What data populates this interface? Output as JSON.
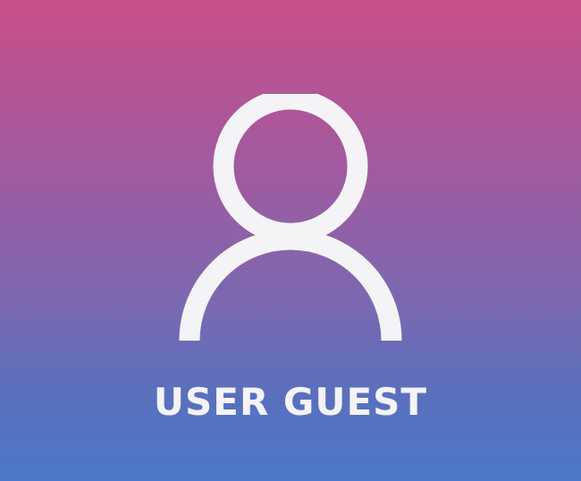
{
  "profile": {
    "icon": "user-icon",
    "name": "USER GUEST"
  },
  "colors": {
    "gradient_top": "#c94f88",
    "gradient_bottom": "#4b78c9",
    "foreground": "#f4f3f6"
  }
}
